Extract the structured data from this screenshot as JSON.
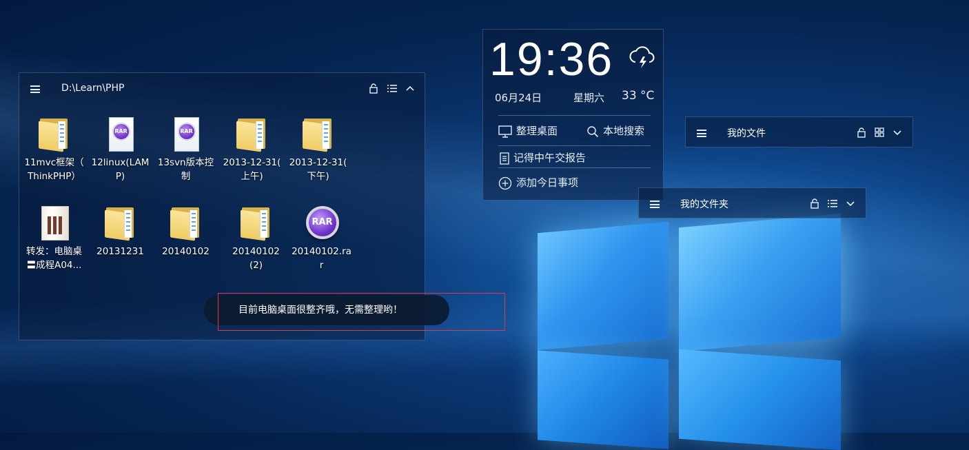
{
  "file_panel": {
    "path": "D:\\Learn\\PHP",
    "items": [
      {
        "label": "11mvc框架（\nThinkPHP）",
        "icon": "folder-icon"
      },
      {
        "label": "12linux(LAM\nP)",
        "icon": "rar-file-icon"
      },
      {
        "label": "13svn版本控\n制",
        "icon": "rar-file-icon"
      },
      {
        "label": "2013-12-31(\n上午)",
        "icon": "folder-icon"
      },
      {
        "label": "2013-12-31(\n下午)",
        "icon": "folder-icon"
      },
      {
        "label": "转发：电脑桌\n〓成程A04...",
        "icon": "document-thumbnail-icon"
      },
      {
        "label": "20131231",
        "icon": "folder-icon"
      },
      {
        "label": "20140102",
        "icon": "folder-icon"
      },
      {
        "label": "20140102\n(2)",
        "icon": "folder-icon"
      },
      {
        "label": "20140102.ra\nr",
        "icon": "winrar-icon"
      }
    ]
  },
  "toast": {
    "message": "目前电脑桌面很整齐哦，无需整理哟！",
    "highlight_color": "#e0394a"
  },
  "clock": {
    "time": "19:36",
    "date": "06月24日",
    "weekday": "星期六",
    "temperature": "33 °C",
    "weather_icon": "thunderstorm-cloud-icon",
    "actions": {
      "organize": "整理桌面",
      "search": "本地搜索",
      "reminder": "记得中午交报告",
      "add_today": "添加今日事项"
    }
  },
  "my_files": {
    "title": "我的文件"
  },
  "my_folder": {
    "title": "我的文件夹"
  },
  "colors": {
    "panel_bg": "rgba(10,28,60,0.55)",
    "folder_yellow": "#efcc63",
    "rar_purple": "#6a2fc5"
  }
}
